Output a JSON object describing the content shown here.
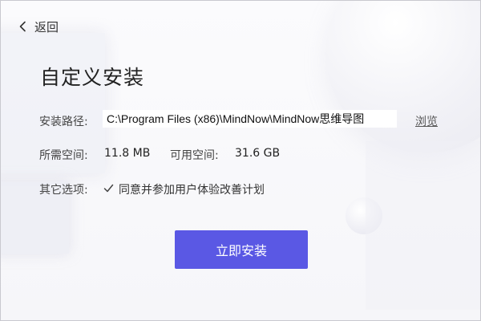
{
  "header": {
    "back_label": "返回",
    "title": "自定义安装"
  },
  "form": {
    "path_label": "安装路径:",
    "path_value": "C:\\Program Files (x86)\\MindNow\\MindNow思维导图",
    "browse_label": "浏览",
    "required_space_label": "所需空间:",
    "required_space_value": "11.8 MB",
    "available_space_label": "可用空间:",
    "available_space_value": "31.6 GB",
    "other_options_label": "其它选项:",
    "agree_checked": true,
    "agree_label": "同意并参加用户体验改善计划"
  },
  "actions": {
    "install_label": "立即安装"
  },
  "colors": {
    "primary_button": "#5a58e4",
    "background": "#f8f8fb"
  },
  "icons": {
    "back": "chevron-left-icon",
    "check": "checkmark-icon"
  }
}
